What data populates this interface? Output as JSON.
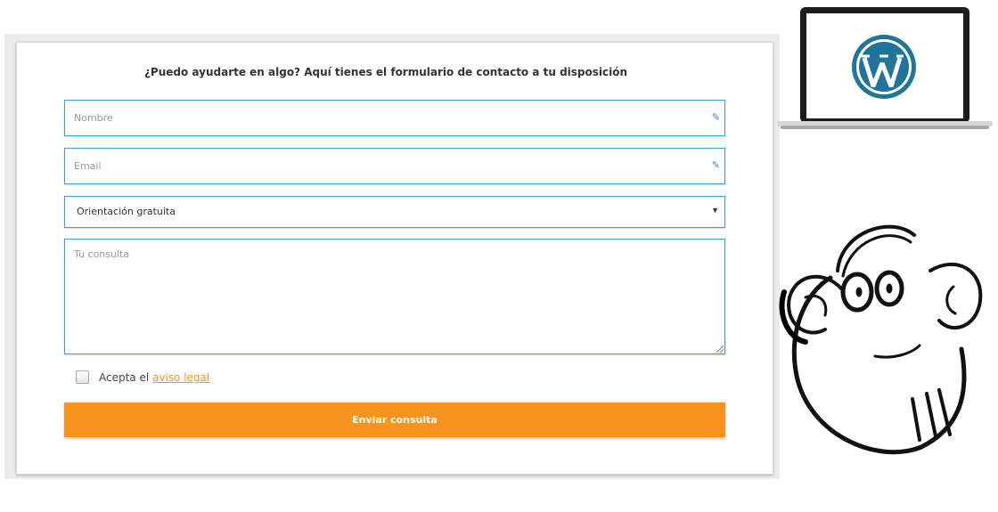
{
  "form": {
    "heading": "¿Puedo ayudarte en algo? Aquí tienes el formulario de contacto a tu disposición",
    "name_placeholder": "Nombre",
    "email_placeholder": "Email",
    "topic_selected": "Orientación gratuita",
    "message_placeholder": "Tu consulta",
    "accept_prefix": "Acepta el",
    "legal_link": "aviso legal",
    "submit_label": "Enviar consulta"
  },
  "icons": {
    "field_edit": "pencil-icon",
    "select_arrow": "triangle-down-icon",
    "laptop_logo": "wordpress-logo",
    "illustration": "monkey-with-headphones"
  },
  "colors": {
    "accent": "#f7931e",
    "field_border": "#3d9ecf",
    "wordpress_blue": "#21759b"
  }
}
